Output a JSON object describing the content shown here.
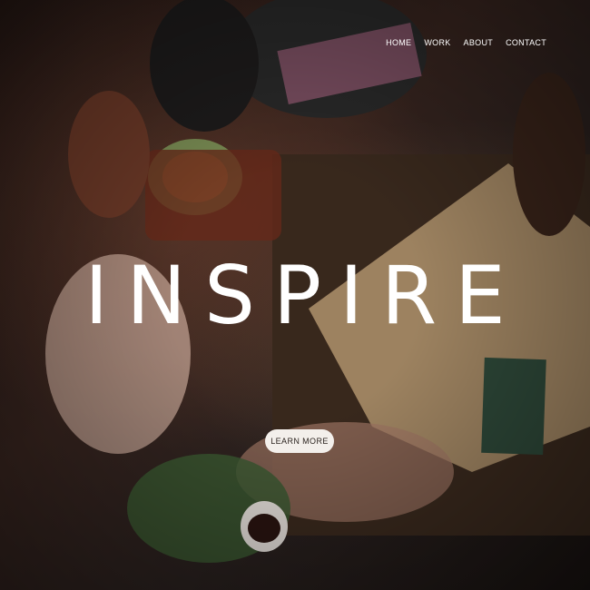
{
  "nav": {
    "items": [
      {
        "label": "HOME"
      },
      {
        "label": "WORK"
      },
      {
        "label": "ABOUT"
      },
      {
        "label": "CONTACT"
      }
    ]
  },
  "hero": {
    "title": "INSPIRE",
    "cta_label": "LEARN MORE"
  },
  "colors": {
    "text": "#ffffff",
    "button_bg": "#f3efeb",
    "button_text": "#2c2420"
  }
}
